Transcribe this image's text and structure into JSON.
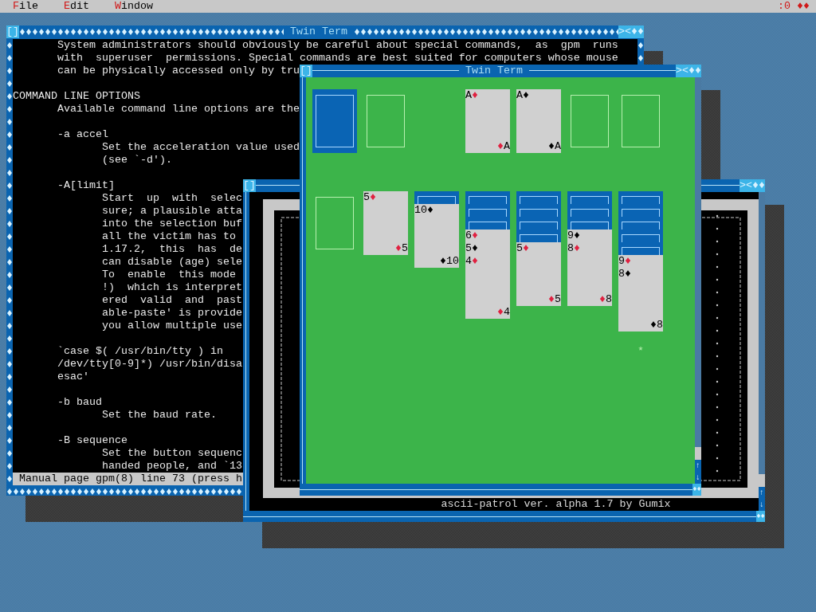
{
  "menu_bar": {
    "items": [
      {
        "label": "File"
      },
      {
        "label": "Edit"
      },
      {
        "label": "Window"
      }
    ],
    "indicator": ":0",
    "corner": "♦♦"
  },
  "man_window": {
    "title": "Twin Term",
    "left_button": "[]",
    "right_buttons": "><♦♦",
    "lines": [
      {
        "kind": "text",
        "text": "       System administrators should obviously be careful about special commands,  as  gpm  runs"
      },
      {
        "kind": "text",
        "text": "       with  superuser  permissions. Special commands are best suited for computers whose mouse"
      },
      {
        "kind": "text",
        "text": "       can be physically accessed only by tru"
      },
      {
        "kind": "blank"
      },
      {
        "kind": "text",
        "text": "COMMAND LINE OPTIONS"
      },
      {
        "kind": "text",
        "text": "       Available command line options are the"
      },
      {
        "kind": "blank"
      },
      {
        "kind": "text",
        "text": "       -a accel"
      },
      {
        "kind": "text",
        "text": "              Set the acceleration value used"
      },
      {
        "kind": "text",
        "text": "              (see `-d')."
      },
      {
        "kind": "blank"
      },
      {
        "kind": "text",
        "text": "       -A[limit]"
      },
      {
        "kind": "text",
        "text": "              Start  up  with  selec"
      },
      {
        "kind": "text",
        "text": "              sure; a plausible atta"
      },
      {
        "kind": "text",
        "text": "              into the selection buf"
      },
      {
        "kind": "text",
        "text": "              all the victim has to"
      },
      {
        "kind": "text",
        "text": "              1.17.2,  this  has  de"
      },
      {
        "kind": "text",
        "text": "              can disable (age) sele"
      },
      {
        "kind": "text",
        "text": "              To  enable  this mode"
      },
      {
        "kind": "text",
        "text": "              !)  which is interpret"
      },
      {
        "kind": "text",
        "text": "              ered  valid  and  past"
      },
      {
        "kind": "text",
        "text": "              able-paste' is provide"
      },
      {
        "kind": "text",
        "text": "              you allow multiple use"
      },
      {
        "kind": "blank"
      },
      {
        "kind": "text",
        "text": "       `case $( /usr/bin/tty ) in"
      },
      {
        "kind": "text",
        "text": "       /dev/tty[0-9]*) /usr/bin/disa"
      },
      {
        "kind": "text",
        "text": "       esac'"
      },
      {
        "kind": "blank"
      },
      {
        "kind": "text",
        "text": "       -b baud"
      },
      {
        "kind": "text",
        "text": "              Set the baud rate."
      },
      {
        "kind": "blank"
      },
      {
        "kind": "text",
        "text": "       -B sequence"
      },
      {
        "kind": "text",
        "text": "              Set the button sequenc"
      },
      {
        "kind": "text",
        "text": "              handed people, and `13"
      }
    ],
    "status": " Manual page gpm(8) line 73 (press h"
  },
  "patrol_window": {
    "left_button": "[]",
    "right_buttons": "><♦♦",
    "status": "ascii-patrol ver. alpha 1.7 by Gumix",
    "scroll_arrows": [
      "↑",
      "↓"
    ],
    "corner": "♦♦"
  },
  "solitaire_window": {
    "title": "Twin Term",
    "left_button": "[]",
    "right_buttons": "><♦♦",
    "top_row": [
      {
        "kind": "stock"
      },
      {
        "kind": "slot"
      },
      {
        "kind": "gap"
      },
      {
        "kind": "card",
        "rank": "A",
        "suit": "♦",
        "corner_suit": "♦",
        "corner_rank": "A",
        "color": "#e02040"
      },
      {
        "kind": "card",
        "rank": "A",
        "suit": "♦",
        "corner_suit": "♦",
        "corner_rank": "A",
        "color": "#000000"
      },
      {
        "kind": "slot"
      },
      {
        "kind": "slot"
      }
    ],
    "tableau": [
      {
        "kind": "empty"
      },
      {
        "kind": "pile",
        "cards": [
          {
            "kind": "face",
            "rank": "5",
            "suit": "♦",
            "color": "#e02040",
            "corner_suit": "♦",
            "corner_rank": "5"
          }
        ]
      },
      {
        "kind": "pile",
        "cards": [
          {
            "kind": "back"
          },
          {
            "kind": "face",
            "rank": "10",
            "suit": "♦",
            "color": "#000000",
            "corner_suit": "♦",
            "corner_rank": "10"
          }
        ]
      },
      {
        "kind": "pile",
        "cards": [
          {
            "kind": "back"
          },
          {
            "kind": "back"
          },
          {
            "kind": "back"
          },
          {
            "kind": "face",
            "rank": "6",
            "suit": "♦",
            "color": "#e02040"
          },
          {
            "kind": "face",
            "rank": "5",
            "suit": "♦",
            "color": "#000000"
          },
          {
            "kind": "face",
            "rank": "4",
            "suit": "♦",
            "color": "#e02040",
            "corner_suit": "♦",
            "corner_rank": "4"
          }
        ]
      },
      {
        "kind": "pile",
        "cards": [
          {
            "kind": "back"
          },
          {
            "kind": "back"
          },
          {
            "kind": "back"
          },
          {
            "kind": "back"
          },
          {
            "kind": "face",
            "rank": "5",
            "suit": "♦",
            "color": "#e02040",
            "corner_suit": "♦",
            "corner_rank": "5"
          }
        ]
      },
      {
        "kind": "pile",
        "cards": [
          {
            "kind": "back"
          },
          {
            "kind": "back"
          },
          {
            "kind": "back"
          },
          {
            "kind": "face",
            "rank": "9",
            "suit": "♦",
            "color": "#000000"
          },
          {
            "kind": "face",
            "rank": "8",
            "suit": "♦",
            "color": "#e02040",
            "corner_suit": "♦",
            "corner_rank": "8"
          }
        ]
      },
      {
        "kind": "pile",
        "cards": [
          {
            "kind": "back"
          },
          {
            "kind": "back"
          },
          {
            "kind": "back"
          },
          {
            "kind": "back"
          },
          {
            "kind": "back"
          },
          {
            "kind": "face",
            "rank": "9",
            "suit": "♦",
            "color": "#e02040"
          },
          {
            "kind": "face",
            "rank": "8",
            "suit": "♦",
            "color": "#000000",
            "corner_suit": "♦",
            "corner_rank": "8"
          }
        ]
      }
    ],
    "marker": "*",
    "scroll_arrows": [
      "↑",
      "↓"
    ],
    "corner": "♦♦"
  }
}
